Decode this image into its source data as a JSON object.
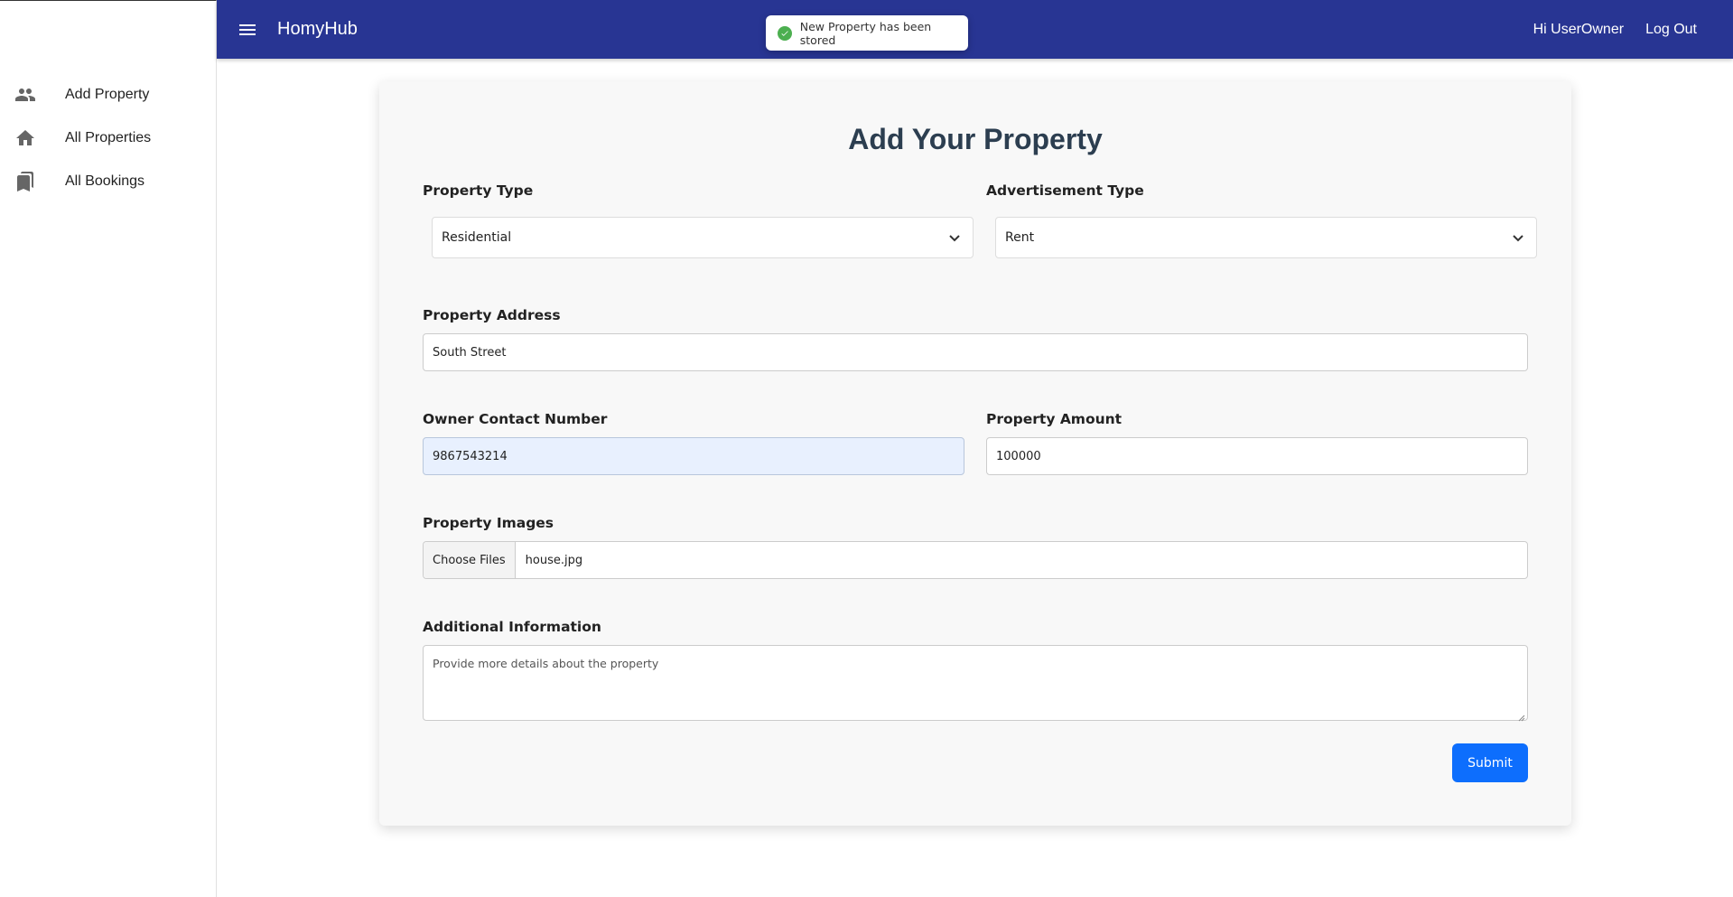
{
  "app": {
    "brand": "HomyHub",
    "greeting": "Hi UserOwner",
    "logout_label": "Log Out"
  },
  "sidebar": {
    "items": [
      {
        "label": "Add Property",
        "icon": "people-icon"
      },
      {
        "label": "All Properties",
        "icon": "home-icon"
      },
      {
        "label": "All Bookings",
        "icon": "bookmarks-icon"
      }
    ]
  },
  "toast": {
    "message": "New Property has been stored",
    "status_color": "#4caf50"
  },
  "form": {
    "title": "Add Your Property",
    "property_type": {
      "label": "Property Type",
      "value": "Residential"
    },
    "advertisement_type": {
      "label": "Advertisement Type",
      "value": "Rent"
    },
    "address": {
      "label": "Property Address",
      "value": "South Street"
    },
    "contact": {
      "label": "Owner Contact Number",
      "value": "9867543214"
    },
    "amount": {
      "label": "Property Amount",
      "value": "100000"
    },
    "images": {
      "label": "Property Images",
      "button_label": "Choose Files",
      "file_name": "house.jpg"
    },
    "additional_info": {
      "label": "Additional Information",
      "placeholder": "Provide more details about the property"
    },
    "submit_label": "Submit"
  },
  "colors": {
    "appbar": "#283593",
    "submit": "#0d6efd"
  }
}
